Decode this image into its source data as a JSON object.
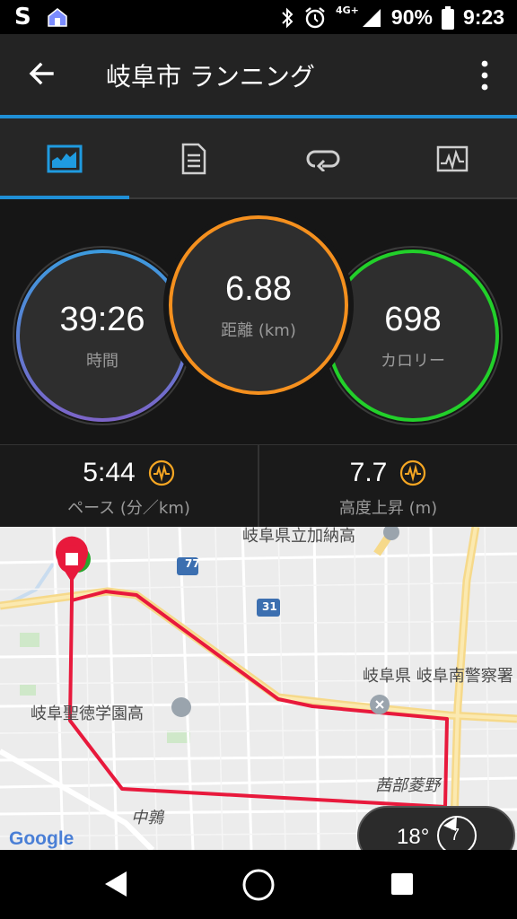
{
  "status_bar": {
    "network": "4G+",
    "battery": "90%",
    "time": "9:23",
    "left_icons": [
      "s-logo-icon",
      "home-app-icon"
    ],
    "right_icons": [
      "bluetooth-icon",
      "alarm-icon",
      "signal-icon"
    ]
  },
  "app_bar": {
    "title": "岐阜市 ランニング",
    "back_icon": "arrow-back-icon",
    "menu_icon": "more-vert-icon"
  },
  "tabs": [
    {
      "name": "summary",
      "icon": "run-stats-icon",
      "active": true
    },
    {
      "name": "details",
      "icon": "document-icon",
      "active": false
    },
    {
      "name": "laps",
      "icon": "loop-icon",
      "active": false
    },
    {
      "name": "graphs",
      "icon": "chart-icon",
      "active": false
    }
  ],
  "stats": {
    "time": {
      "value": "39:26",
      "label": "時間"
    },
    "distance": {
      "value": "6.88",
      "label": "距離 (km)"
    },
    "calories": {
      "value": "698",
      "label": "カロリー"
    }
  },
  "metrics": [
    {
      "value": "5:44",
      "label": "ペース (分／km)",
      "icon": "activity-wave-icon"
    },
    {
      "value": "7.7",
      "label": "高度上昇 (m)",
      "icon": "activity-wave-icon"
    }
  ],
  "map": {
    "labels": {
      "school_top": "岐阜県立加納高",
      "police": "岐阜県 岐阜南警察署",
      "school_left": "岐阜聖徳学園高",
      "area_east": "茜部菱野",
      "area_south": "中鶉",
      "road_77": "77",
      "road_31": "31",
      "google": "Google"
    },
    "weather": {
      "temp": "18°",
      "wind": "7"
    }
  },
  "colors": {
    "accent": "#1f8fd6",
    "time_ring_top": "#3c9bde",
    "time_ring_bottom": "#7c64c8",
    "distance_ring": "#f5901e",
    "calorie_ring": "#22d02a",
    "route": "#e8193c",
    "metric_icon": "#f5a623"
  }
}
